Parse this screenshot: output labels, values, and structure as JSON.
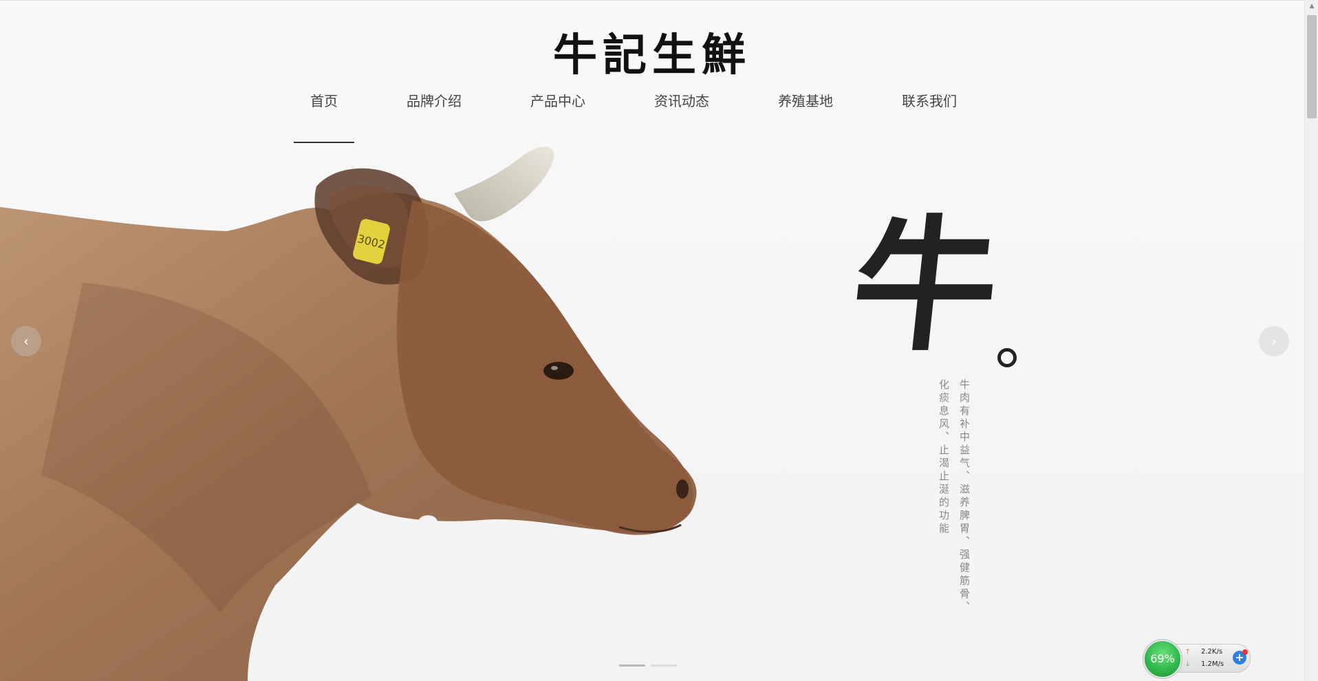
{
  "header": {
    "logo_text": "牛記生鮮"
  },
  "nav": {
    "items": [
      {
        "label": "首页"
      },
      {
        "label": "品牌介绍"
      },
      {
        "label": "产品中心"
      },
      {
        "label": "资讯动态"
      },
      {
        "label": "养殖基地"
      },
      {
        "label": "联系我们"
      }
    ],
    "active_index": 0
  },
  "hero": {
    "big_char": "牛",
    "vertical_lines": [
      "牛肉有补中益气、滋养脾胃、强健筋骨、",
      "化痰息风、止渴止涎的功能"
    ],
    "ear_tag": "3002",
    "prev_icon": "chevron-left-icon",
    "next_icon": "chevron-right-icon",
    "slide_count": 2,
    "active_slide": 0
  },
  "net_widget": {
    "percent": "69%",
    "upload": "2.2K/s",
    "download": "1.2M/s"
  },
  "colors": {
    "nav_text": "#444444",
    "accent_dark": "#222222",
    "widget_green": "#2fb54a",
    "widget_blue": "#2f7fe0"
  }
}
